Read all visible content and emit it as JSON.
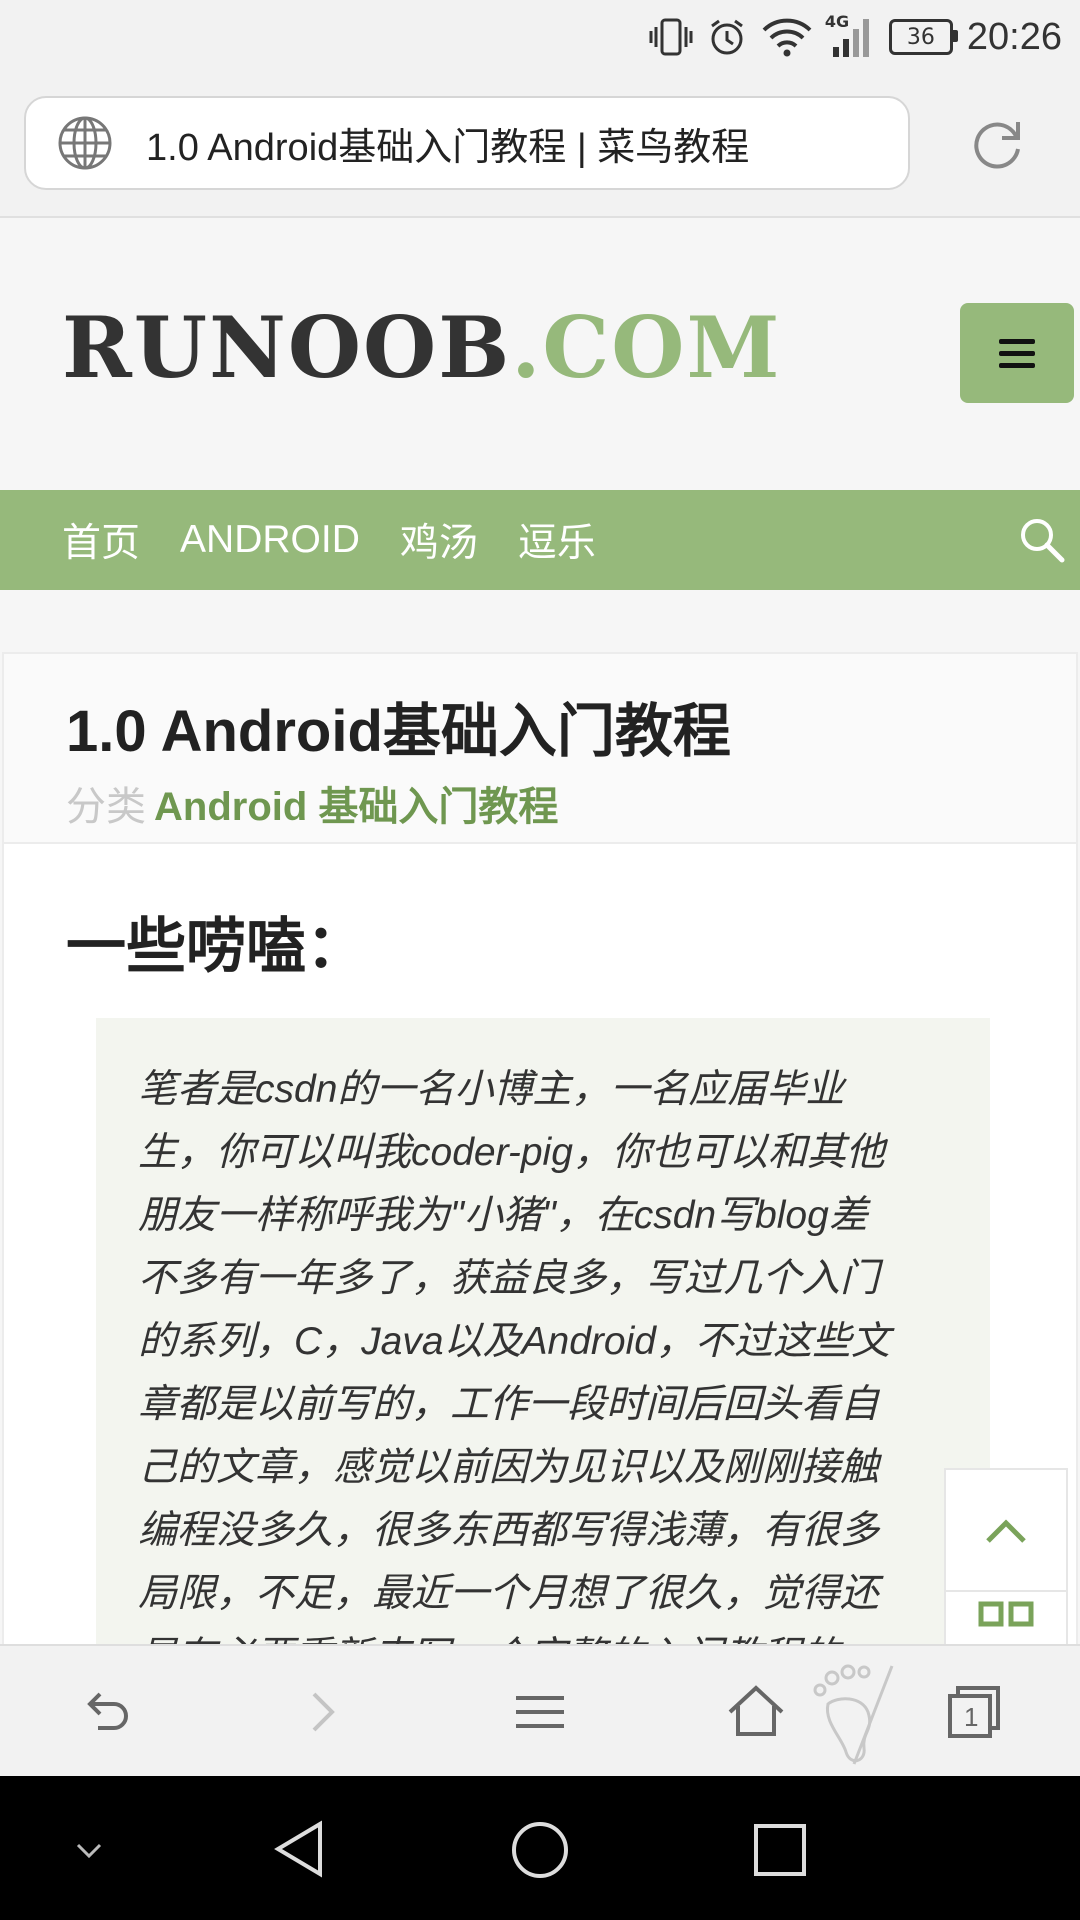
{
  "status_bar": {
    "network": "4G",
    "battery": "36",
    "time": "20:26"
  },
  "browser": {
    "url_title": "1.0 Android基础入门教程 | 菜鸟教程"
  },
  "site": {
    "logo_main": "RUNOOB",
    "logo_suffix": ".COM",
    "accent_color": "#96b97b",
    "nav": [
      "首页",
      "ANDROID",
      "鸡汤",
      "逗乐"
    ]
  },
  "article": {
    "title": "1.0 Android基础入门教程",
    "category_label": "分类",
    "category_value": "Android 基础入门教程",
    "section_heading": "一些唠嗑：",
    "quote_lines": [
      "笔者是csdn的一名小博主，一名应届毕业",
      "生，你可以叫我coder-pig，你也可以和其他",
      "朋友一样称呼我为\"小猪\"，在csdn写blog差",
      "不多有一年多了，获益良多，写过几个入门",
      "的系列，C，Java以及Android，不过这些文",
      "章都是以前写的，工作一段时间后回头看自",
      "己的文章，感觉以前因为见识以及刚刚接触",
      "编程没多久，很多东西都写得浅薄，有很多",
      "局限，不足，最近一个月想了很久，觉得还",
      "是有必要重新来写一个完整的入门教程的"
    ]
  },
  "toolbar": {
    "tabs_count": "1"
  }
}
